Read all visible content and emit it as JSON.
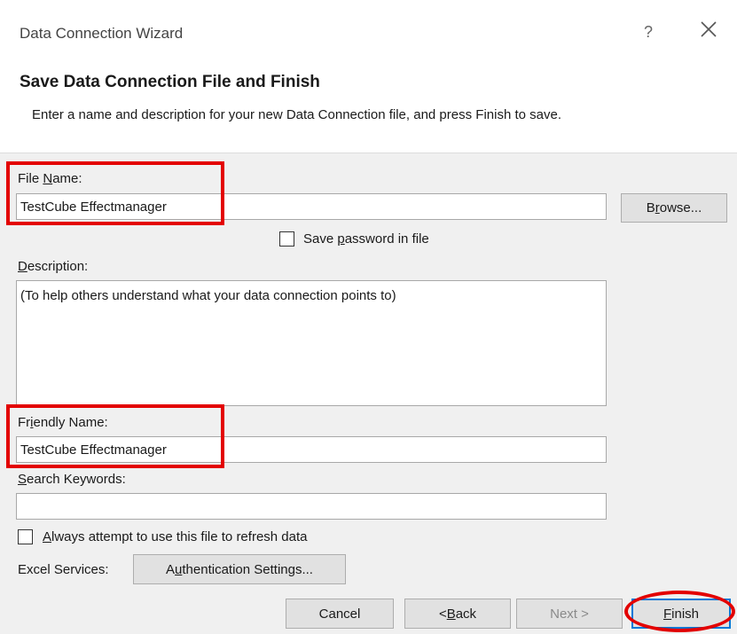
{
  "window": {
    "title": "Data Connection Wizard",
    "help_glyph": "?"
  },
  "header": {
    "heading": "Save Data Connection File and Finish",
    "description": "Enter a name and description for your new Data Connection file, and press Finish to save."
  },
  "form": {
    "file_name_label_pre": "File ",
    "file_name_label_u": "N",
    "file_name_label_post": "ame:",
    "file_name_value": "TestCube Effectmanager",
    "browse_pre": "B",
    "browse_u": "r",
    "browse_post": "owse...",
    "save_password_pre": "Save ",
    "save_password_u": "p",
    "save_password_post": "assword in file",
    "description_label_u": "D",
    "description_label_post": "escription:",
    "description_value": "(To help others understand what your data connection points to)",
    "friendly_name_label_pre": "Fr",
    "friendly_name_label_u": "i",
    "friendly_name_label_post": "endly Name:",
    "friendly_name_value": "TestCube Effectmanager",
    "search_keywords_label_u": "S",
    "search_keywords_label_post": "earch Keywords:",
    "search_keywords_value": "",
    "always_attempt_u": "A",
    "always_attempt_post": "lways attempt to use this file to refresh data",
    "excel_services_label": "Excel Services:",
    "auth_pre": "A",
    "auth_u": "u",
    "auth_post": "thentication Settings..."
  },
  "footer": {
    "cancel": "Cancel",
    "back_pre": "< ",
    "back_u": "B",
    "back_post": "ack",
    "next": "Next >",
    "finish_u": "F",
    "finish_post": "inish"
  },
  "colors": {
    "highlight": "#e30000",
    "focus": "#0078d7"
  }
}
